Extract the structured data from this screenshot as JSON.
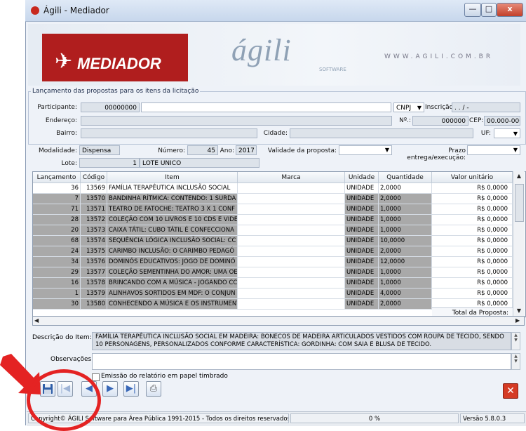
{
  "window": {
    "title": "Ágili - Mediador",
    "btn_min": "—",
    "btn_max": "□",
    "btn_close": "x"
  },
  "banner": {
    "logo_text": "MEDIADOR",
    "brand": "ágili",
    "brand_sub": "SOFTWARE",
    "url": "WWW.AGILI.COM.BR"
  },
  "group_title": "Lançamento das propostas para os itens da licitação",
  "form": {
    "participante_label": "Participante:",
    "participante_code": "00000000",
    "participante_name": "",
    "cnpj": "CNPJ",
    "inscricao_label": "Inscrição:",
    "inscricao_value": ". . / -",
    "endereco_label": "Endereço:",
    "numero_label": "Nº.:",
    "numero_value": "000000",
    "cep_label": "CEP:",
    "cep_value": "00.000-000",
    "bairro_label": "Bairro:",
    "cidade_label": "Cidade:",
    "uf_label": "UF:"
  },
  "licitacao": {
    "modalidade_label": "Modalidade:",
    "modalidade": "Dispensa",
    "numero_label": "Número:",
    "numero": "45",
    "ano_label": "Ano:",
    "ano": "2017",
    "validade_label": "Validade da proposta:",
    "prazo_label": "Prazo entrega/execução:",
    "lote_label": "Lote:",
    "lote_num": "1",
    "lote_nome": "LOTE UNICO"
  },
  "grid": {
    "headers": [
      "Lançamento",
      "Código",
      "Item",
      "Marca",
      "Unidade",
      "Quantidade",
      "Valor unitário"
    ],
    "rows": [
      [
        "36",
        "13569",
        "FAMÍLIA TERAPÊUTICA INCLUSÃO SOCIAL",
        "",
        "UNIDADE",
        "2,0000",
        "R$ 0,0000"
      ],
      [
        "7",
        "13570",
        "BANDINHA RÍTMICA: CONTENDO: 1 SURDA",
        "",
        "UNIDADE",
        "2,0000",
        "R$ 0,0000"
      ],
      [
        "71",
        "13571",
        "TEATRO DE FATOCHE: TEATRO 3 X 1 CONF",
        "",
        "UNIDADE",
        "1,0000",
        "R$ 0,0000"
      ],
      [
        "28",
        "13572",
        "COLEÇÃO COM 10 LIVROS E 10 CDS E VIDE",
        "",
        "UNIDADE",
        "1,0000",
        "R$ 0,0000"
      ],
      [
        "20",
        "13573",
        "CAIXA TÁTIL: CUBO TÁTIL É CONFECCIONA",
        "",
        "UNIDADE",
        "1,0000",
        "R$ 0,0000"
      ],
      [
        "68",
        "13574",
        "SEQUÊNCIA LÓGICA INCLUSÃO SOCIAL: CC",
        "",
        "UNIDADE",
        "10,0000",
        "R$ 0,0000"
      ],
      [
        "24",
        "13575",
        "CARIMBO INCLUSÃO: O CARIMBO PEDAGÓ",
        "",
        "UNIDADE",
        "2,0000",
        "R$ 0,0000"
      ],
      [
        "34",
        "13576",
        "DOMINÓS EDUCATIVOS: JOGO DE DOMINÓ",
        "",
        "UNIDADE",
        "12,0000",
        "R$ 0,0000"
      ],
      [
        "29",
        "13577",
        "COLEÇÃO SEMENTINHA DO AMOR: UMA OE",
        "",
        "UNIDADE",
        "1,0000",
        "R$ 0,0000"
      ],
      [
        "16",
        "13578",
        "BRINCANDO COM A MÚSICA - JOGANDO CC",
        "",
        "UNIDADE",
        "1,0000",
        "R$ 0,0000"
      ],
      [
        "1",
        "13579",
        "ALINHAVOS SORTIDOS EM MDF: O CONJUN",
        "",
        "UNIDADE",
        "4,0000",
        "R$ 0,0000"
      ],
      [
        "30",
        "13580",
        "CONHECENDO A MÚSICA E OS INSTRUMENT",
        "",
        "UNIDADE",
        "2,0000",
        "R$ 0,0000"
      ]
    ],
    "total_label": "Total da Proposta:"
  },
  "descricao_label": "Descrição do Item:",
  "descricao": "FAMÍLIA TERAPÊUTICA INCLUSÃO SOCIAL EM MADEIRA: BONECOS DE MADEIRA ARTICULADOS VESTIDOS COM ROUPA DE TECIDO, SENDO 10 PERSONAGENS, PERSONALIZADOS CONFORME CARACTERÍSTICA: GORDINHA: COM SAIA E BLUSA DE TECIDO.",
  "observacoes_label": "Observações:",
  "checkbox_label": "Emissão do relatório em papel timbrado",
  "status": {
    "copyright": "Copyright© ÁGILI Software para Área Pública 1991-2015 - Todos os direitos reservados.",
    "percent": "0 %",
    "version": "Versão 5.8.0.3"
  },
  "colors": {
    "brand_red": "#b01e1e",
    "annotation_red": "#e42323"
  }
}
